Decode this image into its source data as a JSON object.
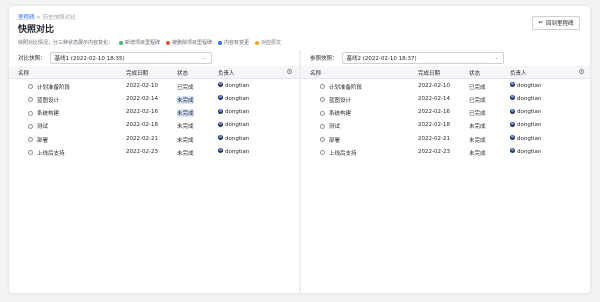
{
  "breadcrumb": {
    "link": "里程碑",
    "separator": " > ",
    "current": "历史快照对比"
  },
  "title": "快照对比",
  "hint": {
    "text": "快照对比情况，分三种状态展示内容变化：",
    "legend": [
      {
        "label": "新增项目里程碑",
        "color": "#3fb96d"
      },
      {
        "label": "被删除项目里程碑",
        "color": "#e4572e"
      },
      {
        "label": "内容有变更",
        "color": "#3370ff"
      },
      {
        "label": "对应原文",
        "color": "#f5a623"
      }
    ]
  },
  "back_button": {
    "label": "回到里程碑",
    "icon": "arrow-left-icon"
  },
  "left": {
    "control_label": "对比快照：",
    "selected": "基线1 (2022-02-10 18:35)",
    "columns": [
      "名称",
      "完成日期",
      "状态",
      "负责人"
    ],
    "rows": [
      {
        "name": "计划准备阶段",
        "date": "2022-02-10",
        "status": "已完成",
        "owner": "dongtian",
        "status_hl": false
      },
      {
        "name": "蓝图设计",
        "date": "2022-02-14",
        "status": "未完成",
        "owner": "dongtian",
        "status_hl": true
      },
      {
        "name": "系统构建",
        "date": "2022-02-16",
        "status": "未完成",
        "owner": "dongtian",
        "status_hl": true
      },
      {
        "name": "测试",
        "date": "2022-02-18",
        "status": "未完成",
        "owner": "dongtian",
        "status_hl": false
      },
      {
        "name": "部署",
        "date": "2022-02-21",
        "status": "未完成",
        "owner": "dongtian",
        "status_hl": false
      },
      {
        "name": "上线后支持",
        "date": "2022-02-23",
        "status": "未完成",
        "owner": "dongtian",
        "status_hl": false
      }
    ]
  },
  "right": {
    "control_label": "参照快照：",
    "selected": "基线2 (2022-02-10 18:37)",
    "columns": [
      "名称",
      "完成日期",
      "状态",
      "负责人"
    ],
    "rows": [
      {
        "name": "计划准备阶段",
        "date": "2022-02-10",
        "status": "已完成",
        "owner": "dongtian",
        "status_hl": false
      },
      {
        "name": "蓝图设计",
        "date": "2022-02-14",
        "status": "已完成",
        "owner": "dongtian",
        "status_hl": false
      },
      {
        "name": "系统构建",
        "date": "2022-02-16",
        "status": "已完成",
        "owner": "dongtian",
        "status_hl": false
      },
      {
        "name": "测试",
        "date": "2022-02-18",
        "status": "未完成",
        "owner": "dongtian",
        "status_hl": false
      },
      {
        "name": "部署",
        "date": "2022-02-21",
        "status": "未完成",
        "owner": "dongtian",
        "status_hl": false
      },
      {
        "name": "上线后支持",
        "date": "2022-02-23",
        "status": "未完成",
        "owner": "dongtian",
        "status_hl": false
      }
    ]
  }
}
